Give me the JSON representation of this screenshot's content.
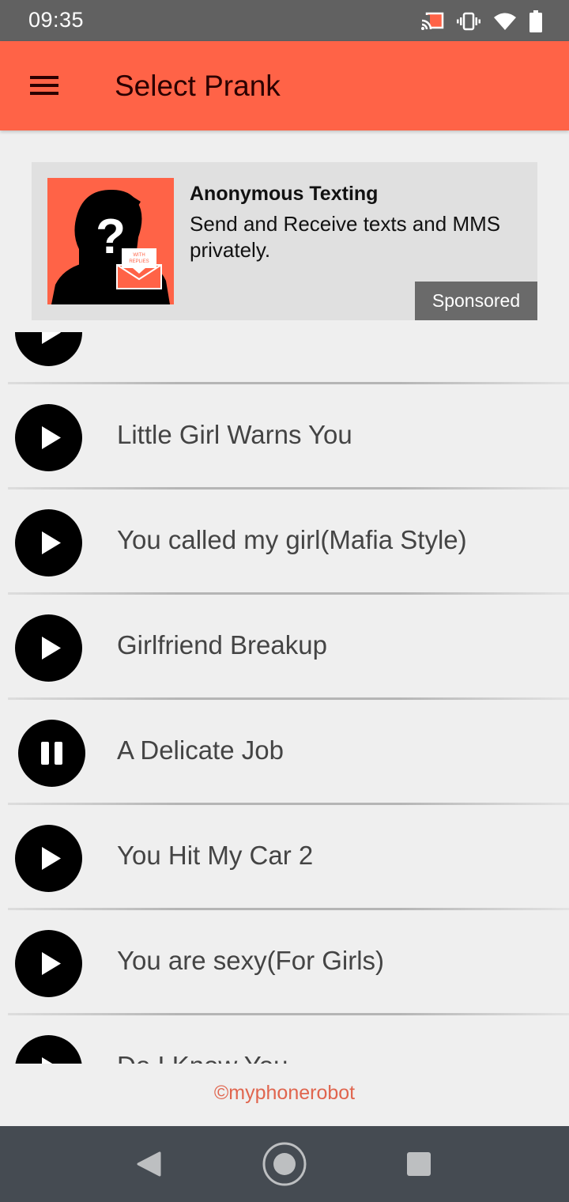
{
  "status_bar": {
    "time": "09:35",
    "icons": [
      "cast-icon",
      "vibrate-icon",
      "wifi-icon",
      "battery-icon"
    ],
    "cast_color": "#ff6347"
  },
  "toolbar": {
    "menu_icon": "hamburger-menu-icon",
    "title": "Select Prank",
    "background": "#ff6347"
  },
  "ad": {
    "image": "anonymous-person-silhouette-with-envelope",
    "image_envelope_text": "WITH REPLIES",
    "title": "Anonymous Texting",
    "description": "Send and Receive texts and MMS privately.",
    "badge": "Sponsored"
  },
  "pranks": [
    {
      "title": "",
      "state": "play"
    },
    {
      "title": "Little Girl Warns You",
      "state": "play"
    },
    {
      "title": "You called my girl(Mafia Style)",
      "state": "play"
    },
    {
      "title": "Girlfriend Breakup",
      "state": "play"
    },
    {
      "title": "A Delicate Job",
      "state": "pause"
    },
    {
      "title": "You Hit My Car 2",
      "state": "play"
    },
    {
      "title": "You are sexy(For Girls)",
      "state": "play"
    },
    {
      "title": "Do I Know You",
      "state": "play"
    }
  ],
  "footer": {
    "copyright": "©myphonerobot"
  },
  "nav_bar": {
    "buttons": [
      "back-icon",
      "home-icon",
      "recents-icon"
    ]
  }
}
